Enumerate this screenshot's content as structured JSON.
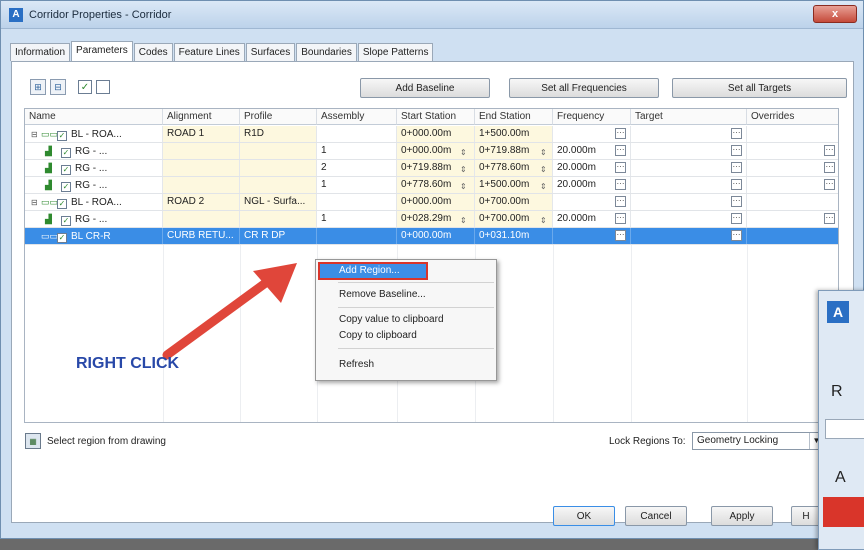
{
  "window": {
    "title": "Corridor Properties - Corridor",
    "close_label": "x"
  },
  "tabs": [
    "Information",
    "Parameters",
    "Codes",
    "Feature Lines",
    "Surfaces",
    "Boundaries",
    "Slope Patterns"
  ],
  "toolbar": {
    "add_baseline": "Add Baseline",
    "set_all_frequencies": "Set all Frequencies",
    "set_all_targets": "Set all Targets"
  },
  "columns": [
    "Name",
    "Alignment",
    "Profile",
    "Assembly",
    "Start Station",
    "End Station",
    "Frequency",
    "Target",
    "Overrides"
  ],
  "rows": [
    {
      "name": "BL - ROA...",
      "alignment": "ROAD 1",
      "profile": "R1D",
      "assembly": "",
      "start": "0+000.00m",
      "end": "1+500.00m",
      "frequency": ""
    },
    {
      "name": "RG - ...",
      "alignment": "",
      "profile": "",
      "assembly": "1",
      "start": "0+000.00m",
      "end": "0+719.88m",
      "frequency": "20.000m"
    },
    {
      "name": "RG - ...",
      "alignment": "",
      "profile": "",
      "assembly": "2",
      "start": "0+719.88m",
      "end": "0+778.60m",
      "frequency": "20.000m"
    },
    {
      "name": "RG - ...",
      "alignment": "",
      "profile": "",
      "assembly": "1",
      "start": "0+778.60m",
      "end": "1+500.00m",
      "frequency": "20.000m"
    },
    {
      "name": "BL - ROA...",
      "alignment": "ROAD 2",
      "profile": "NGL - Surfa...",
      "assembly": "",
      "start": "0+000.00m",
      "end": "0+700.00m",
      "frequency": ""
    },
    {
      "name": "RG - ...",
      "alignment": "",
      "profile": "",
      "assembly": "1",
      "start": "0+028.29m",
      "end": "0+700.00m",
      "frequency": "20.000m"
    },
    {
      "name": "BL CR-R",
      "alignment": "CURB RETU...",
      "profile": "CR R DP",
      "assembly": "",
      "start": "0+000.00m",
      "end": "0+031.10m",
      "frequency": ""
    }
  ],
  "context_menu": [
    "Add Region...",
    "Remove Baseline...",
    "Copy value to clipboard",
    "Copy to clipboard",
    "Refresh"
  ],
  "annotation": "RIGHT CLICK",
  "bottom": {
    "select_region": "Select region from drawing",
    "lock_label": "Lock Regions To:",
    "lock_value": "Geometry Locking",
    "ok": "OK",
    "cancel": "Cancel",
    "apply": "Apply",
    "help": "H"
  },
  "partial_dialog": {
    "letter_r": "R",
    "letter_a": "A"
  }
}
